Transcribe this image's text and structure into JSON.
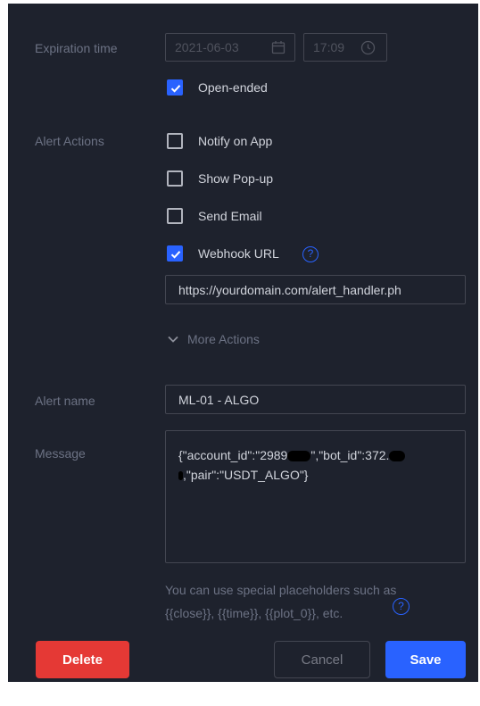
{
  "expiration": {
    "label": "Expiration time",
    "date": "2021-06-03",
    "time": "17:09",
    "open_ended_label": "Open-ended"
  },
  "alert_actions": {
    "label": "Alert Actions",
    "items": [
      {
        "label": "Notify on App",
        "checked": false
      },
      {
        "label": "Show Pop-up",
        "checked": false
      },
      {
        "label": "Send Email",
        "checked": false
      },
      {
        "label": "Webhook URL",
        "checked": true
      }
    ],
    "webhook_url": "https://yourdomain.com/alert_handler.ph",
    "more_actions_label": "More Actions"
  },
  "alert_name": {
    "label": "Alert name",
    "value": "ML-01 - ALGO"
  },
  "message": {
    "label": "Message",
    "line1_a": "{\"account_id\":\"2989",
    "line1_b": "\",\"bot_id\":372.",
    "line2": ",\"pair\":\"USDT_ALGO\"}"
  },
  "hint": {
    "line1": "You can use special placeholders such as",
    "line2": "{{close}}, {{time}}, {{plot_0}}, etc."
  },
  "buttons": {
    "delete": "Delete",
    "cancel": "Cancel",
    "save": "Save"
  },
  "colors": {
    "background": "#1e222d",
    "accent": "#2962ff",
    "delete": "#e53935"
  }
}
